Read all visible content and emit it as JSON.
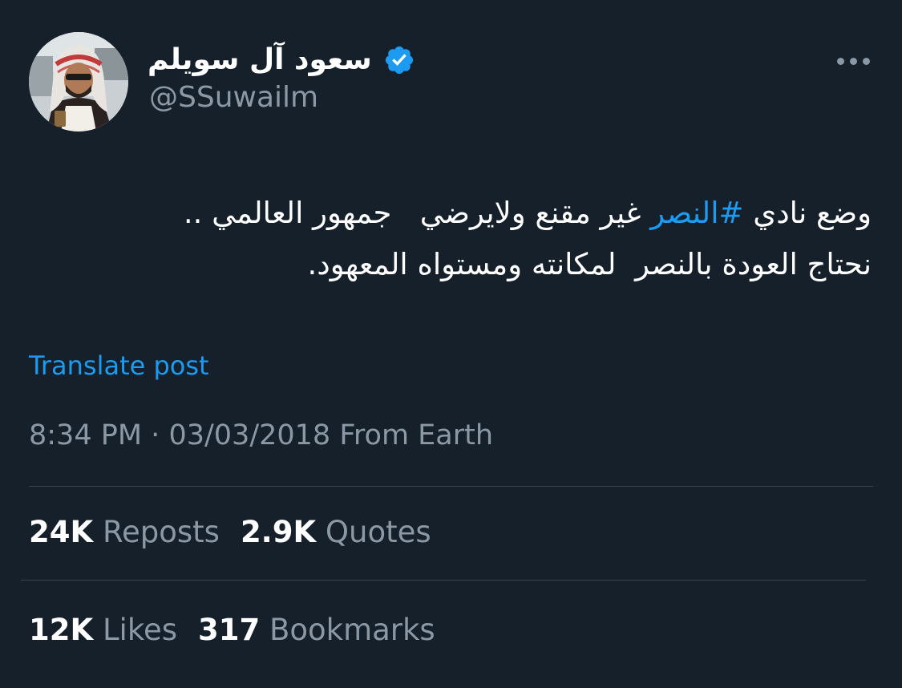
{
  "author": {
    "display_name": "سعود آل سويلم",
    "handle": "@SSuwailm",
    "verified": true
  },
  "tweet": {
    "text_before_hashtag": "وضع نادي ",
    "hashtag": "#النصر",
    "text_after_hashtag": " غير مقنع ولايرضي   جمهور العالمي ..\nنحتاج العودة بالنصر  لمكانته ومستواه المعهود."
  },
  "translate_label": "Translate post",
  "meta": {
    "time": "8:34 PM",
    "separator": "·",
    "date": "03/03/2018",
    "source": "From Earth"
  },
  "stats": {
    "reposts": {
      "value": "24K",
      "label": "Reposts"
    },
    "quotes": {
      "value": "2.9K",
      "label": "Quotes"
    },
    "likes": {
      "value": "12K",
      "label": "Likes"
    },
    "bookmarks": {
      "value": "317",
      "label": "Bookmarks"
    }
  },
  "colors": {
    "background": "#15202b",
    "accent": "#1d9bf0",
    "secondary_text": "#8b98a5",
    "divider": "#38444d"
  },
  "icons": {
    "verified": "verified-badge-icon",
    "more": "more-dots-icon"
  }
}
